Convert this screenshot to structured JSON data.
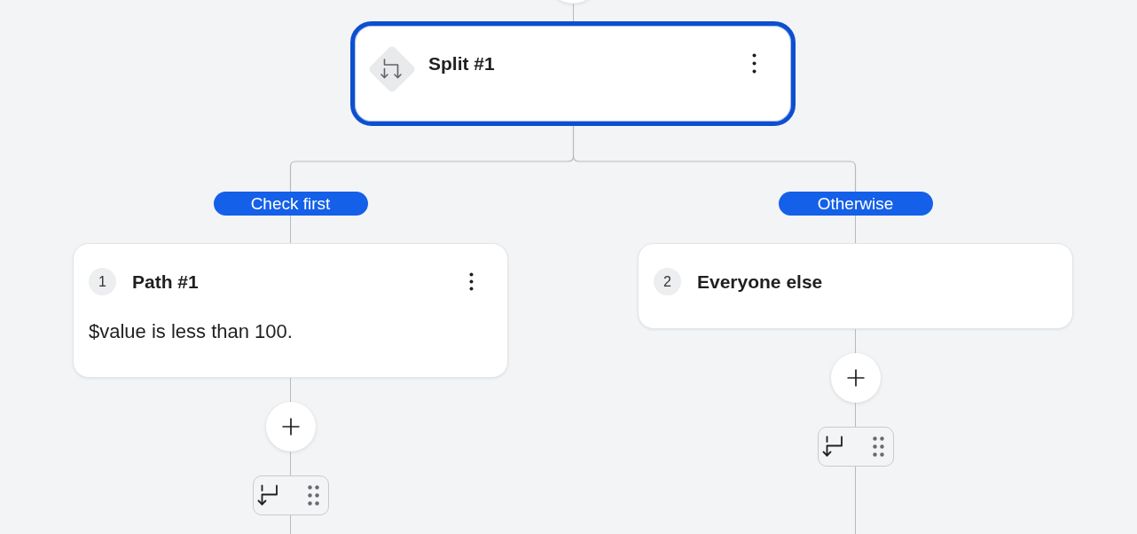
{
  "flow": {
    "split": {
      "title": "Split #1",
      "selected": true
    },
    "branches": [
      {
        "label": "Check first",
        "kind": "condition",
        "number": "1",
        "title": "Path #1",
        "selected": false,
        "condition": "$value is less than 100."
      },
      {
        "label": "Otherwise",
        "kind": "fallback",
        "number": "2",
        "title": "Everyone else",
        "selected": false
      }
    ]
  }
}
